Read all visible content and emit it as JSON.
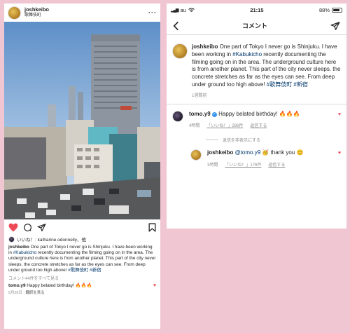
{
  "post": {
    "username": "joshkeibo",
    "location": "歌舞伎町",
    "liked_by": "いいね！: katharine.odonnelly、他",
    "caption_start": "One part of Tokyo I never go is Shinjuku. I have been working in ",
    "caption_tag": "#Kabukicho",
    "caption_rest": " recently documenting the filming going on in the area. The underground culture here is from another planet. This part of the city never sleeps. the concrete stretches as far as the eyes can see. From deep under ground too high above! ",
    "caption_tags_end": "#歌舞伎町 #新宿",
    "view_all": "コメント44件をすべて見る",
    "comment_user": "tomo.y9",
    "comment_text": "Happy belated birthday! 🔥🔥🔥",
    "date": "5月28日",
    "translate": "翻訳を見る"
  },
  "statusbar": {
    "carrier": "au",
    "time": "21:15",
    "battery": "88%",
    "battery_level": 0.88
  },
  "comments_screen": {
    "title": "コメント",
    "caption_user": "joshkeibo",
    "caption_start": "One part of Tokyo I never go is Shinjuku. I have been working in ",
    "caption_tag": "#Kabukicho",
    "caption_rest": " recently documenting the filming going on in the area. The underground culture here is from another planet. This part of the city never sleeps. the concrete stretches as far as the eyes can see. From deep under ground too high above! ",
    "caption_tags_end": "#歌舞伎町 #新宿",
    "caption_time": "1週間前",
    "comment1": {
      "user": "tomo.y9",
      "text": "Happy belated birthday! 🔥🔥🔥",
      "time": "4時間",
      "likes": "「いいね！」286件",
      "reply": "返信する"
    },
    "hide_replies": "返信を非表示にする",
    "reply1": {
      "user": "joshkeibo",
      "mention": "@tomo.y9",
      "text": " 🥳 thank you 😊",
      "time": "3時間",
      "likes": "「いいね！」176件",
      "reply": "返信する"
    }
  },
  "icons": {
    "heart": "heart-icon",
    "comment": "comment-icon",
    "share": "send-icon",
    "bookmark": "bookmark-icon",
    "back": "chevron-left-icon",
    "dm": "send-icon"
  }
}
